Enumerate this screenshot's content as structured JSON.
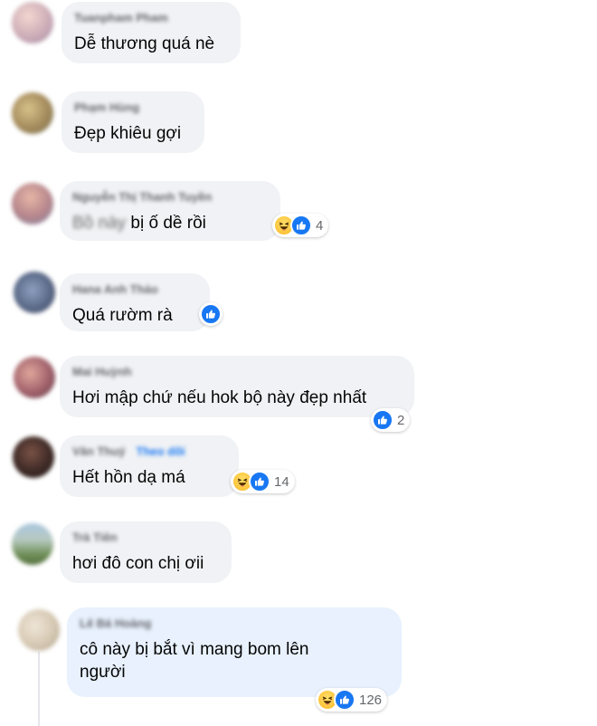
{
  "comments": [
    {
      "author": "Tuanpham Pham",
      "text": "Dễ thương quá nè"
    },
    {
      "author": "Phạm Hùng",
      "text": "Đẹp khiêu gợi"
    },
    {
      "author": "Nguyễn Thị Thanh Tuyền",
      "text_prefix": "Bồ này",
      "text": " bị ố dề rồi",
      "reaction_count": "4"
    },
    {
      "author": "Hana Anh Thảo",
      "text": "Quá rườm rà"
    },
    {
      "author": "Mai Huỳnh",
      "text": "Hơi mập chứ nếu hok bộ này đẹp nhất",
      "reaction_count": "2"
    },
    {
      "author": "Văn Thuý",
      "follow": "Theo dõi",
      "text": "Hết hồn dạ má",
      "reaction_count": "14"
    },
    {
      "author": "Trà Tiên",
      "text": "hơi đô con chị ơii"
    },
    {
      "author": "Lê Bá Hoàng",
      "text_line1": "cô này bị bắt vì mang bom lên",
      "text_line2": "người",
      "reaction_count": "126"
    }
  ],
  "icons": {
    "like": "like-icon",
    "haha": "haha-icon"
  },
  "colors": {
    "bubble": "#f0f2f5",
    "bubble_highlight": "#e8f1fd",
    "like": "#1877f2",
    "haha": "#fbc43a",
    "name": "#65676b"
  }
}
